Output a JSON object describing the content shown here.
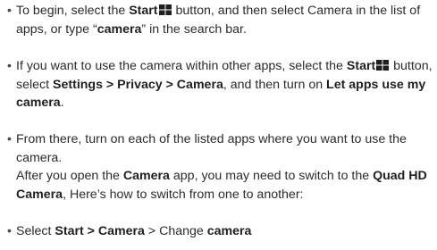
{
  "items": [
    {
      "parts": [
        {
          "t": "To begin, select the ",
          "b": false
        },
        {
          "t": "Start",
          "b": true
        },
        {
          "icon": "windows-logo-icon"
        },
        {
          "t": " button, and then select Camera in the list of apps, or type “",
          "b": false
        },
        {
          "t": "camera",
          "b": true
        },
        {
          "t": "” in the search bar.",
          "b": false
        }
      ]
    },
    {
      "parts": [
        {
          "t": "If you want to use the camera within other apps, select the ",
          "b": false
        },
        {
          "t": "Start",
          "b": true
        },
        {
          "icon": "windows-logo-icon"
        },
        {
          "t": " button, select ",
          "b": false
        },
        {
          "t": "Settings > Privacy > Camera",
          "b": true
        },
        {
          "t": ", and then turn on ",
          "b": false
        },
        {
          "t": "Let apps use my camera",
          "b": true
        },
        {
          "t": ".",
          "b": false
        }
      ]
    },
    {
      "parts": [
        {
          "t": "From there, turn on each of the listed apps where you want to use the camera.",
          "b": false
        },
        {
          "br": true
        },
        {
          "t": "After you open the ",
          "b": false
        },
        {
          "t": "Camera",
          "b": true
        },
        {
          "t": " app, you may need to switch to the ",
          "b": false
        },
        {
          "t": "Quad HD Camera",
          "b": true
        },
        {
          "t": ", Here’s how to switch from one to another:",
          "b": false
        }
      ]
    },
    {
      "parts": [
        {
          "t": "Select ",
          "b": false
        },
        {
          "t": "Start > Camera",
          "b": true
        },
        {
          "t": " > Change ",
          "b": false
        },
        {
          "t": "camera",
          "b": true
        }
      ]
    }
  ],
  "bullet_char": "•"
}
